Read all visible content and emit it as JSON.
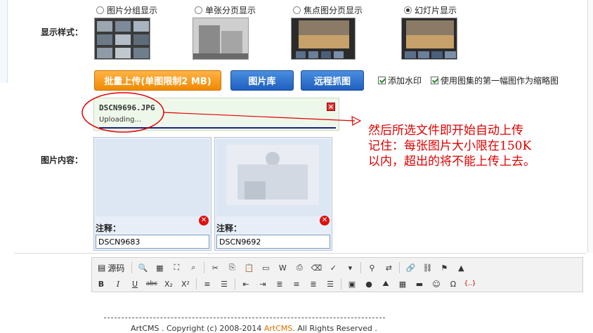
{
  "display_style": {
    "label": "显示样式：",
    "options": [
      {
        "label": "图片分组显示",
        "selected": false
      },
      {
        "label": "单张分页显示",
        "selected": false
      },
      {
        "label": "焦点图分页显示",
        "selected": false
      },
      {
        "label": "幻灯片显示",
        "selected": true
      }
    ]
  },
  "actions": {
    "batch_upload": "批量上传(单图限制2 MB)",
    "gallery": "图片库",
    "remote_fetch": "远程抓图",
    "watermark": "添加水印",
    "use_first_as_thumb": "使用图集的第一幅图作为缩略图"
  },
  "upload_progress": {
    "filename": "DSCN9696.JPG",
    "status": "Uploading...",
    "close_icon": "close-icon"
  },
  "annotation": {
    "line1": "然后所选文件即开始自动上传",
    "line2": "记住：每张图片大小限在150K",
    "line3": "以内，超出的将不能上传上去。",
    "color": "#e00000"
  },
  "content": {
    "label": "图片内容：",
    "images": [
      {
        "note_label": "注释：",
        "note_value": "DSCN9683"
      },
      {
        "note_label": "注释：",
        "note_value": "DSCN9692"
      }
    ]
  },
  "editor_toolbar": {
    "source_label": "源码"
  },
  "footer": {
    "prefix": "ArtCMS . Copyright (c) 2008-2014 ",
    "brand": "ArtCMS",
    "suffix": ". All Rights Reserved ."
  }
}
